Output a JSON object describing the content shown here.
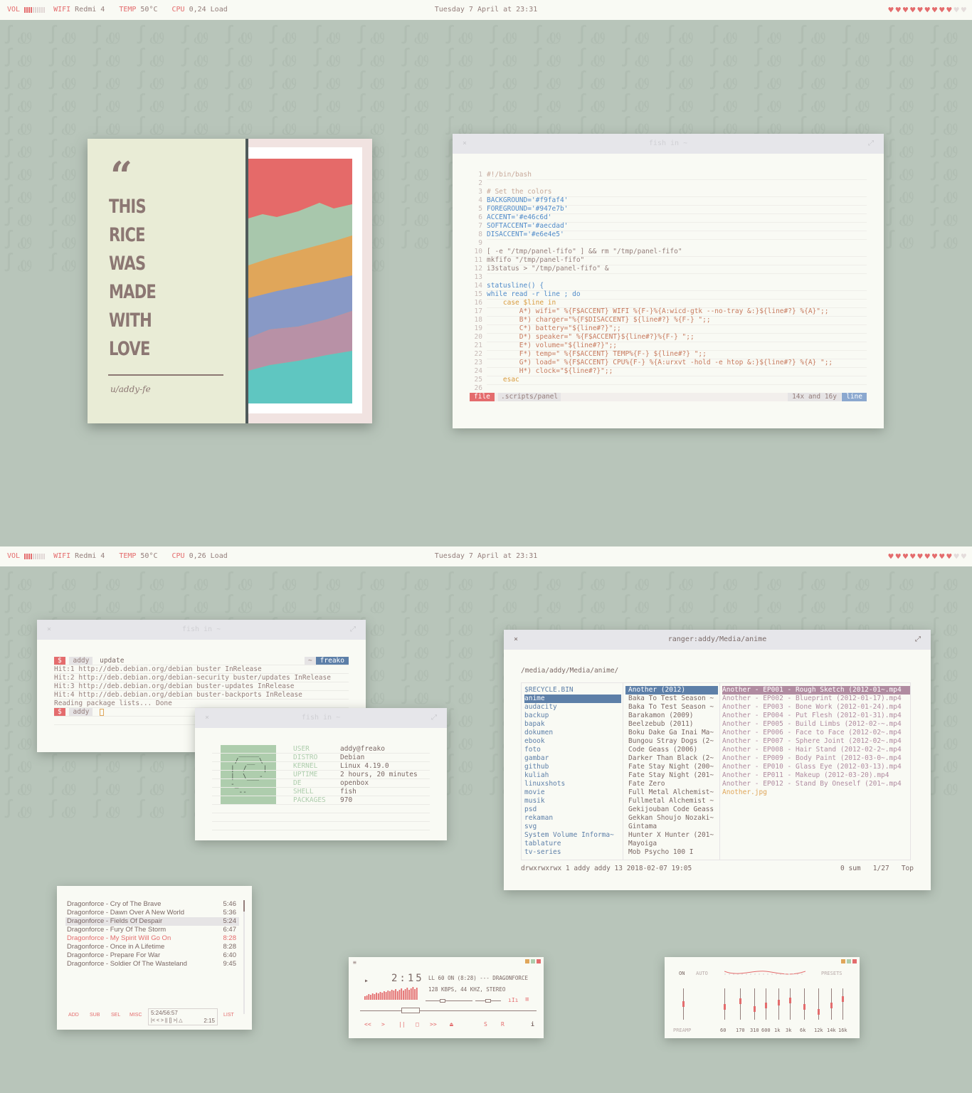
{
  "panel": {
    "vol_label": "VOL",
    "wifi_label": "WIFI",
    "wifi_value": "Redmi 4",
    "temp_label": "TEMP",
    "temp_value": "50°C",
    "cpu_label": "CPU",
    "cpu_value_top": "0,24 Load",
    "cpu_value_bottom": "0,26 Load",
    "clock": "Tuesday 7 April at 23:31",
    "hearts": "♥",
    "hearts_on": 9,
    "hearts_total": 11
  },
  "wallpaper": {
    "glyphs": "ꭍꮺ ꭍꮺ ꭍꮺ ꭍꮺ ꭍꮺ ꭍꮺ ꭍꮺ ꭍꮺ ꭍꮺ ꭍꮺ ꭍꮺ ꭍꮺ ꭍꮺ ꭍꮺ ꭍꮺ ꭍꮺ ꭍꮺ ꭍꮺ ꭍꮺ ꭍꮺ ꭍꮺ ꭍꮺ ꭍꮺ ꭍꮺ ꭍꮺ ꭍꮺ ꭍꮺ ꭍꮺ ꭍꮺ ꭍꮺ ꭍꮺ ꭍꮺ ꭍꮺ ꭍꮺ ꭍꮺ ꭍꮺ ꭍꮺ ꭍꮺ ꭍꮺ ꭍꮺ ꭍꮺ ꭍꮺ ꭍꮺ ꭍꮺ ꭍꮺ ꭍꮺ ꭍꮺ ꭍꮺ ꭍꮺ ꭍꮺ ꭍꮺ ꭍꮺ ꭍꮺ ꭍꮺ ꭍꮺ ꭍꮺ ꭍꮺ ꭍꮺ ꭍꮺ ꭍꮺ ꭍꮺ ꭍꮺ ꭍꮺ ꭍꮺ ꭍꮺ ꭍꮺ ꭍꮺ ꭍꮺ ꭍꮺ ꭍꮺ ꭍꮺ ꭍꮺ ꭍꮺ ꭍꮺ ꭍꮺ ꭍꮺ ꭍꮺ ꭍꮺ ꭍꮺ ꭍꮺ ꭍꮺ ꭍꮺ ꭍꮺ ꭍꮺ ꭍꮺ ꭍꮺ ꭍꮺ ꭍꮺ ꭍꮺ ꭍꮺ ꭍꮺ ꭍꮺ ꭍꮺ ꭍꮺ ꭍꮺ ꭍꮺ ꭍꮺ ꭍꮺ ꭍꮺ ꭍꮺ ꭍꮺ ꭍꮺ ꭍꮺ ꭍꮺ ꭍꮺ ꭍꮺ ꭍꮺ ꭍꮺ ꭍꮺ ꭍꮺ ꭍꮺ ꭍꮺ ꭍꮺ ꭍꮺ ꭍꮺ ꭍꮺ ꭍꮺ ꭍꮺ ꭍꮺ ꭍꮺ ꭍꮺ ꭍꮺ ꭍꮺ ꭍꮺ ꭍꮺ ꭍꮺ ꭍꮺ ꭍꮺ ꭍꮺ ꭍꮺ ꭍꮺ ꭍꮺ ꭍꮺ ꭍꮺ ꭍꮺ ꭍꮺ ꭍꮺ ꭍꮺ ꭍꮺ ꭍꮺ ꭍꮺ ꭍꮺ ꭍꮺ ꭍꮺ ꭍꮺ ꭍꮺ ꭍꮺ ꭍꮺ ꭍꮺ ꭍꮺ ꭍꮺ ꭍꮺ ꭍꮺ ꭍꮺ ꭍꮺ ꭍꮺ ꭍꮺ ꭍꮺ ꭍꮺ ꭍꮺ ꭍꮺ ꭍꮺ ꭍꮺ ꭍꮺ ꭍꮺ ꭍꮺ ꭍꮺ ꭍꮺ ꭍꮺ ꭍꮺ ꭍꮺ ꭍꮺ ꭍꮺ ꭍꮺ ꭍꮺ ꭍꮺ ꭍꮺ ꭍꮺ ꭍꮺ ꭍꮺ ꭍꮺ ꭍꮺ ꭍꮺ ꭍꮺ ꭍꮺ ꭍꮺ ꭍꮺ ꭍꮺ ꭍꮺ ꭍꮺ ꭍꮺ ꭍꮺ ꭍꮺ ꭍꮺ ꭍꮺ ꭍꮺ ꭍꮺ ꭍꮺ ꭍꮺ ꭍꮺ ꭍꮺ ꭍꮺ ꭍꮺ ꭍꮺ ꭍꮺ ꭍꮺ ꭍꮺ ꭍꮺ ꭍꮺ ꭍꮺ ꭍꮺ ꭍꮺ ꭍꮺ ꭍꮺ ꭍꮺ ꭍꮺ ꭍꮺ ꭍꮺ ꭍꮺ ꭍꮺ ꭍꮺ ꭍꮺ ꭍꮺ ꭍꮺ ꭍꮺ ꭍꮺ ꭍꮺ ꭍꮺ ꭍꮺ"
  },
  "card": {
    "quote_mark": "“",
    "lines": [
      "THIS",
      "RICE",
      "WAS",
      "MADE",
      "WITH",
      "LOVE"
    ],
    "signature": "u/addy-fe"
  },
  "editor": {
    "title": "fish in ~",
    "close": "×",
    "maximize": "⤢",
    "lines": [
      "#!/bin/bash",
      "",
      "# Set the colors",
      "BACKGROUND='#f9faf4'",
      "FOREGROUND='#947e7b'",
      "ACCENT='#e46c6d'",
      "SOFTACCENT='#aecdad'",
      "DISACCENT='#e6e4e5'",
      "",
      "[ -e \"/tmp/panel-fifo\" ] && rm \"/tmp/panel-fifo\"",
      "mkfifo \"/tmp/panel-fifo\"",
      "i3status > \"/tmp/panel-fifo\" &",
      "",
      "statusline() {",
      "while read -r line ; do",
      "    case $line in",
      "        A*) wifi=\" %{F$ACCENT} WIFI %{F-}%{A:wicd-gtk --no-tray &:}${line#?} %{A}\";;",
      "        B*) charger=\"%{F$DISACCENT} ${line#?} %{F-} \";;",
      "        C*) battery=\"${line#?}\";;",
      "        D*) speaker=\" %{F$ACCENT}${line#?}%{F-} \";;",
      "        E*) volume=\"${line#?}\";;",
      "        F*) temp=\" %{F$ACCENT} TEMP%{F-} ${line#?} \";;",
      "        G*) load=\" %{F$ACCENT} CPU%{F-} %{A:urxvt -hold -e htop &:}${line#?} %{A} \";;",
      "        H*) clock=\"${line#?}\";;",
      "    esac",
      ""
    ],
    "status_mode": "file",
    "status_path": ".scripts/panel",
    "status_pos": "14x and 16y",
    "status_right": "line"
  },
  "term1": {
    "title": "fish in ~",
    "close": "×",
    "maximize": "⤢",
    "prompt_sym": "$",
    "user": "addy",
    "command": "update",
    "home": "~",
    "host": "freako",
    "output": [
      "Hit:1 http://deb.debian.org/debian buster InRelease",
      "Hit:2 http://deb.debian.org/debian-security buster/updates InRelease",
      "Hit:3 http://deb.debian.org/debian buster-updates InRelease",
      "Hit:4 http://deb.debian.org/debian buster-backports InRelease",
      "Reading package lists... Done"
    ]
  },
  "term2": {
    "title": "fish in ~",
    "close": "×",
    "maximize": "⤢",
    "ascii": "  _____\n /  __ \\\n|  /    |\n|  \\___-\n-_\n  --_",
    "info": [
      {
        "k": "USER",
        "v": "addy@freako"
      },
      {
        "k": "DISTRO",
        "v": "Debian"
      },
      {
        "k": "KERNEL",
        "v": "Linux 4.19.0"
      },
      {
        "k": "UPTIME",
        "v": "2 hours, 20 minutes"
      },
      {
        "k": "DE",
        "v": "openbox"
      },
      {
        "k": "SHELL",
        "v": "fish"
      },
      {
        "k": "PACKAGES",
        "v": "970"
      }
    ]
  },
  "ranger": {
    "title": "ranger:addy/Media/anime",
    "close": "×",
    "maximize": "⤢",
    "path": "/media/addy/Media/anime/",
    "col1": [
      "$RECYCLE.BIN",
      "anime",
      "audacity",
      "backup",
      "bapak",
      "dokumen",
      "ebook",
      "foto",
      "gambar",
      "github",
      "kuliah",
      "linuxshots",
      "movie",
      "musik",
      "psd",
      "rekaman",
      "svg",
      "System Volume Informa~",
      "tablature",
      "tv-series"
    ],
    "col2": [
      "Another (2012)",
      "Baka To Test Season ~",
      "Baka To Test Season ~",
      "Barakamon (2009)",
      "Beelzebub (2011)",
      "Boku Dake Ga Inai Ma~",
      "Bungou Stray Dogs (2~",
      "Code Geass (2006)",
      "Darker Than Black (2~",
      "Fate Stay Night (200~",
      "Fate Stay Night (201~",
      "Fate Zero",
      "Full Metal Alchemist~",
      "Fullmetal Alchemist ~",
      "Gekijouban Code Geass",
      "Gekkan Shoujo Nozaki~",
      "Gintama",
      "Hunter X Hunter (201~",
      "Mayoiga",
      "Mob Psycho 100 I"
    ],
    "col3": [
      "Another - EP001 - Rough Sketch (2012-01~.mp4",
      "Another - EP002 - Blueprint (2012-01-17).mp4",
      "Another - EP003 - Bone Work (2012-01-24).mp4",
      "Another - EP004 - Put Flesh (2012-01-31).mp4",
      "Another - EP005 - Build Limbs (2012-02-~.mp4",
      "Another - EP006 - Face to Face (2012-02~.mp4",
      "Another - EP007 - Sphere Joint (2012-02~.mp4",
      "Another - EP008 - Hair Stand (2012-02-2~.mp4",
      "Another - EP009 - Body Paint (2012-03-0~.mp4",
      "Another - EP010 - Glass Eye (2012-03-13).mp4",
      "Another - EP011 - Makeup (2012-03-20).mp4",
      "Another - EP012 - Stand By Oneself (201~.mp4",
      "Another.jpg"
    ],
    "footer_left": "drwxrwxrwx 1 addy addy 13 2018-02-07 19:05",
    "footer_right": "0 sum   1/27   Top"
  },
  "playlist": {
    "tracks": [
      {
        "t": "Dragonforce - Cry of The Brave",
        "d": "5:46"
      },
      {
        "t": "Dragonforce - Dawn Over A New World",
        "d": "5:36"
      },
      {
        "t": "Dragonforce - Fields Of Despair",
        "d": "5:24"
      },
      {
        "t": "Dragonforce - Fury Of The Storm",
        "d": "6:47"
      },
      {
        "t": "Dragonforce - My Spirit Will Go On",
        "d": "8:28"
      },
      {
        "t": "Dragonforce - Once in A Lifetime",
        "d": "8:28"
      },
      {
        "t": "Dragonforce - Prepare For War",
        "d": "6:40"
      },
      {
        "t": "Dragonforce - Soldier Of The Wasteland",
        "d": "9:45"
      }
    ],
    "btn_add": "ADD",
    "btn_sub": "SUB",
    "btn_sel": "SEL",
    "btn_misc": "MISC",
    "btn_list": "LIST",
    "total": "5:24/56:57",
    "mini_controls": "|< < > || [] >| △",
    "elapsed": "2:15"
  },
  "player": {
    "time": "2:15",
    "ticker": "LL 60 ON (8:28) --- DRAGONFORCE",
    "bitrate": "128 KBPS, 44 KHZ, STEREO",
    "controls": {
      "prev": "<<",
      "play": ">",
      "pause": "||",
      "stop": "□",
      "next": ">>",
      "eject": "⏏",
      "shuffle": "S",
      "repeat": "R",
      "info": "i"
    }
  },
  "eq": {
    "on": "ON",
    "auto": "AUTO",
    "presets": "PRESETS",
    "preamp": "PREAMP",
    "bands": [
      "60",
      "170",
      "310",
      "600",
      "1k",
      "3k",
      "6k",
      "12k",
      "14k",
      "16k"
    ]
  },
  "colors": {
    "accent": "#e46c6d",
    "foreground": "#947e7b",
    "background": "#f9faf4",
    "soft": "#aecdad",
    "dis": "#e6e4e5",
    "blue": "#5d7fa8"
  }
}
